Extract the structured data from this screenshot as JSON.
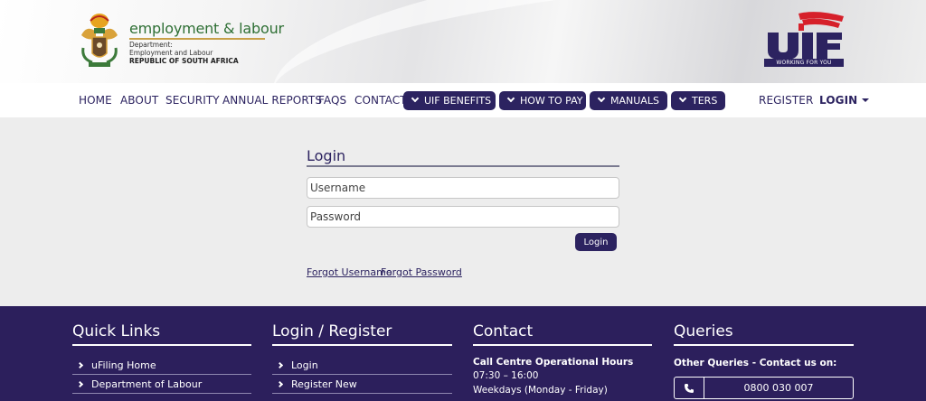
{
  "header": {
    "brand": "employment & labour",
    "dept_line1": "Department:",
    "dept_line2": "Employment and Labour",
    "dept_line3": "REPUBLIC OF SOUTH AFRICA",
    "uif_tagline": "WORKING FOR YOU"
  },
  "nav": {
    "home": "HOME",
    "about": "ABOUT",
    "security": "SECURITY",
    "annual_reports": "ANNUAL REPORTS",
    "faqs": "FAQS",
    "contact": "CONTACT",
    "uif_benefits": "UIF BENEFITS",
    "how_to_pay": "HOW TO PAY",
    "manuals": "MANUALS",
    "ters": "TERS",
    "register": "REGISTER",
    "login": "LOGIN"
  },
  "login": {
    "title": "Login",
    "username_placeholder": "Username",
    "password_placeholder": "Password",
    "button": "Login",
    "forgot_username": "Forgot Username",
    "forgot_password": "Forgot Password"
  },
  "footer": {
    "quick_links": {
      "title": "Quick Links",
      "items": [
        "uFiling Home",
        "Department of Labour"
      ]
    },
    "login_register": {
      "title": "Login / Register",
      "items": [
        "Login",
        "Register New"
      ]
    },
    "contact": {
      "title": "Contact",
      "hours_title": "Call Centre Operational Hours",
      "hours": "07:30 – 16:00",
      "days": "Weekdays (Monday - Friday)"
    },
    "queries": {
      "title": "Queries",
      "subtitle": "Other Queries - Contact us on:",
      "phone": "0800 030 007"
    }
  },
  "colors": {
    "primary": "#2c2360",
    "footer_bg": "#2c1f5c",
    "brand_green": "#2e6f34",
    "uif_red": "#d6202a"
  }
}
